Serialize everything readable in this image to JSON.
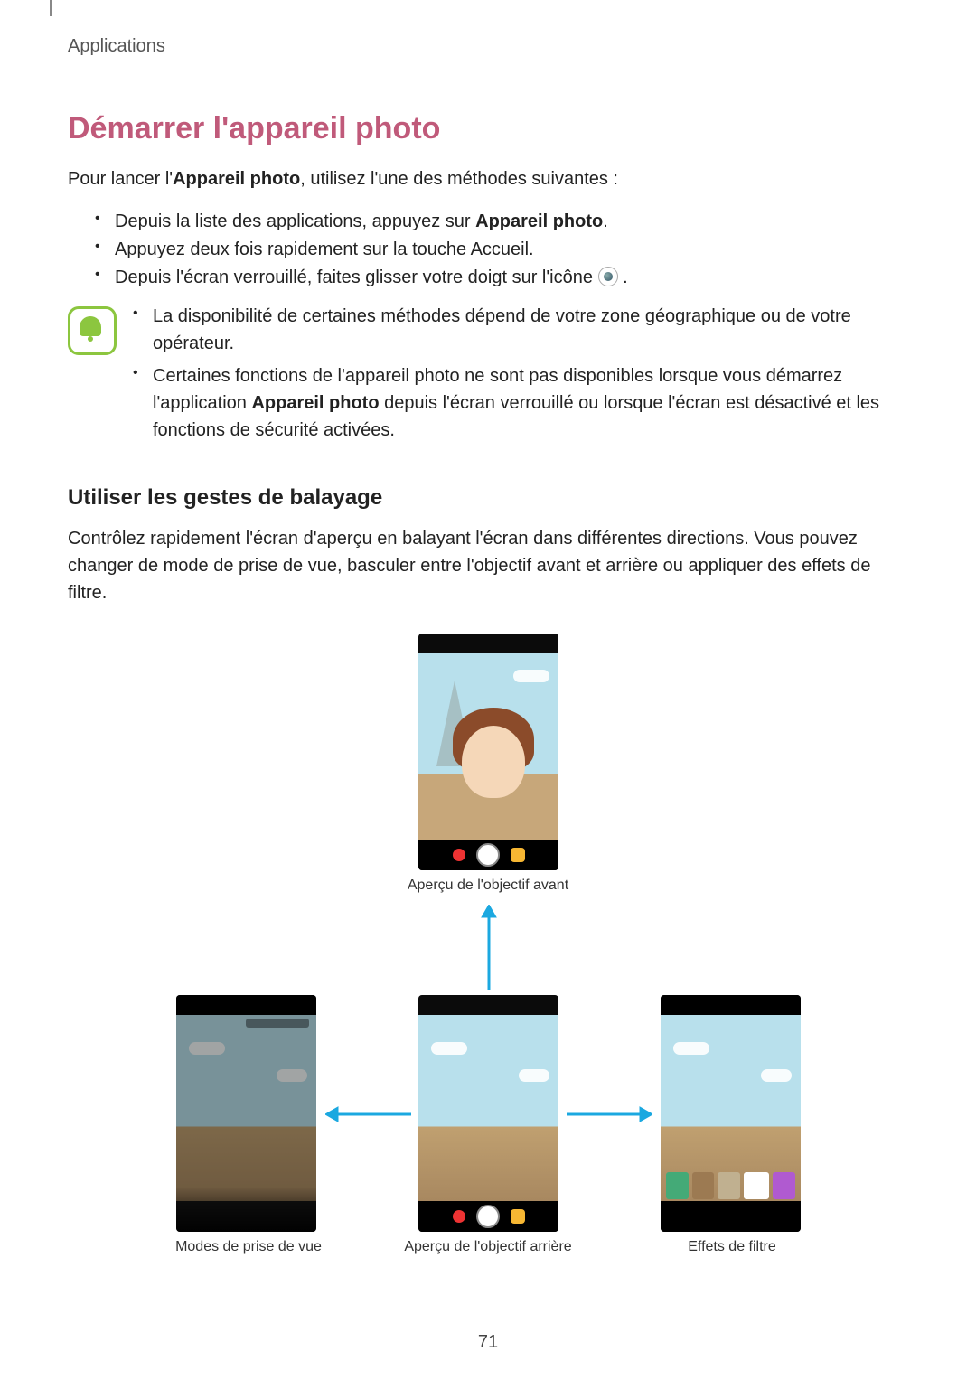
{
  "header": {
    "category": "Applications"
  },
  "title": "Démarrer l'appareil photo",
  "intro_pre": "Pour lancer l'",
  "intro_bold": "Appareil photo",
  "intro_post": ", utilisez l'une des méthodes suivantes :",
  "bullets": {
    "b1_pre": "Depuis la liste des applications, appuyez sur ",
    "b1_bold": "Appareil photo",
    "b1_post": ".",
    "b2": "Appuyez deux fois rapidement sur la touche Accueil.",
    "b3_pre": "Depuis l'écran verrouillé, faites glisser votre doigt sur l'icône ",
    "b3_post": "."
  },
  "note": {
    "n1": "La disponibilité de certaines méthodes dépend de votre zone géographique ou de votre opérateur.",
    "n2_pre": "Certaines fonctions de l'appareil photo ne sont pas disponibles lorsque vous démarrez l'application ",
    "n2_bold": "Appareil photo",
    "n2_post": " depuis l'écran verrouillé ou lorsque l'écran est désactivé et les fonctions de sécurité activées."
  },
  "subsection": "Utiliser les gestes de balayage",
  "para": "Contrôlez rapidement l'écran d'aperçu en balayant l'écran dans différentes directions. Vous pouvez changer de mode de prise de vue, basculer entre l'objectif avant et arrière ou appliquer des effets de filtre.",
  "captions": {
    "front_preview": "Aperçu de l'objectif avant",
    "rear_preview": "Aperçu de l'objectif arrière",
    "modes": "Modes de prise de vue",
    "filters": "Effets de filtre"
  },
  "page_number": "71"
}
